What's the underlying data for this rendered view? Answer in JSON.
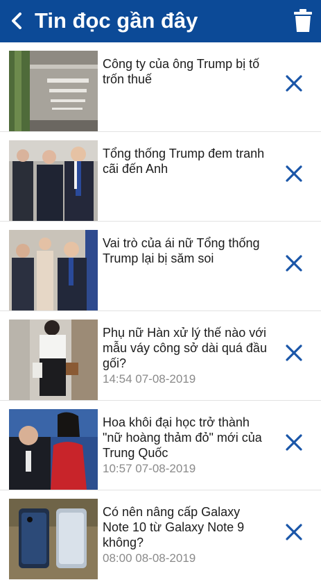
{
  "header": {
    "title": "Tin đọc gần đây",
    "back_icon": "chevron-left-icon",
    "delete_all_icon": "trash-icon",
    "background": "#0c4a97"
  },
  "items": [
    {
      "title": "Công ty của ông Trump bị tố trốn thuế",
      "time": ""
    },
    {
      "title": "Tổng thống Trump đem tranh cãi đến Anh",
      "time": ""
    },
    {
      "title": "Vai trò của ái nữ Tổng thống Trump lại bị săm soi",
      "time": ""
    },
    {
      "title": " Phụ nữ Hàn xử lý thế nào với mẫu váy công sở dài quá đầu gối?",
      "time": "14:54 07-08-2019"
    },
    {
      "title": " Hoa khôi đại học trở thành \"nữ hoàng thảm đỏ\" mới của Trung Quốc",
      "time": "10:57 07-08-2019"
    },
    {
      "title": " Có nên nâng cấp Galaxy Note 10 từ Galaxy Note 9 không?",
      "time": "08:00 08-08-2019"
    }
  ],
  "remove_icon": "close-icon",
  "accent": "#1a56a8"
}
